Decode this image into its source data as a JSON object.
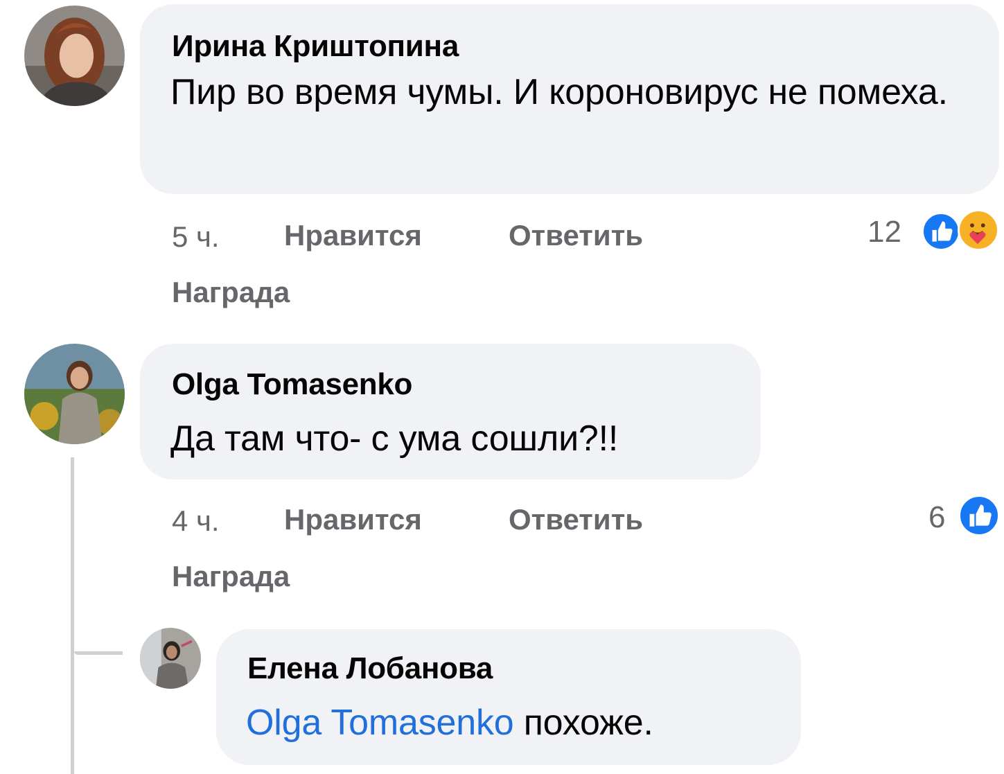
{
  "comments": [
    {
      "author": "Ирина Криштопина",
      "text": "Пир во время чумы. И короновирус не помеха.",
      "time": "5 ч.",
      "like_label": "Нравится",
      "reply_label": "Ответить",
      "award_label": "Награда",
      "reaction_count": "12",
      "reactions": [
        "like-icon",
        "care-icon"
      ]
    },
    {
      "author": "Olga Tomasenko",
      "text": "Да там что- с ума сошли?!!",
      "time": "4 ч.",
      "like_label": "Нравится",
      "reply_label": "Ответить",
      "award_label": "Награда",
      "reaction_count": "6",
      "reactions": [
        "like-icon"
      ]
    }
  ],
  "reply": {
    "author": "Елена Лобанова",
    "mention": "Olga Tomasenko",
    "text": " похоже."
  },
  "colors": {
    "bubble": "#f0f2f5",
    "meta": "#65676b",
    "mention": "#216fdb",
    "like_blue": "#1877f2"
  }
}
